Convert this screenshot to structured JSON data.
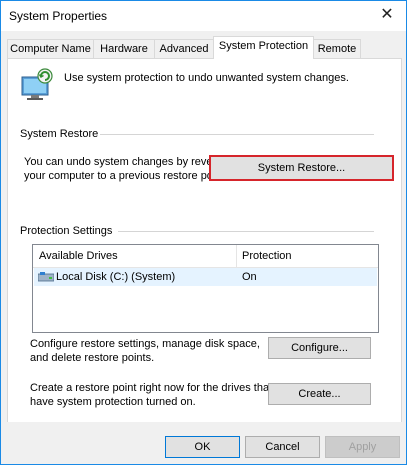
{
  "window": {
    "title": "System Properties",
    "close_glyph": "✕"
  },
  "tabs": [
    {
      "label": "Computer Name",
      "active": false
    },
    {
      "label": "Hardware",
      "active": false
    },
    {
      "label": "Advanced",
      "active": false
    },
    {
      "label": "System Protection",
      "active": true
    },
    {
      "label": "Remote",
      "active": false
    }
  ],
  "intro": {
    "icon": "computer-shield-icon",
    "text": "Use system protection to undo unwanted system changes."
  },
  "system_restore": {
    "group_label": "System Restore",
    "description_line1": "You can undo system changes by reverting",
    "description_line2": "your computer to a previous restore point.",
    "button_label": "System Restore...",
    "highlight_color": "#d6252b"
  },
  "protection_settings": {
    "group_label": "Protection Settings",
    "columns": [
      "Available Drives",
      "Protection"
    ],
    "drives": [
      {
        "icon": "drive-icon",
        "name": "Local Disk (C:) (System)",
        "protection": "On"
      }
    ],
    "configure_text_line1": "Configure restore settings, manage disk space,",
    "configure_text_line2": "and delete restore points.",
    "configure_button": "Configure...",
    "create_text_line1": "Create a restore point right now for the drives that",
    "create_text_line2": "have system protection turned on.",
    "create_button": "Create..."
  },
  "footer": {
    "ok": "OK",
    "cancel": "Cancel",
    "apply": "Apply"
  }
}
